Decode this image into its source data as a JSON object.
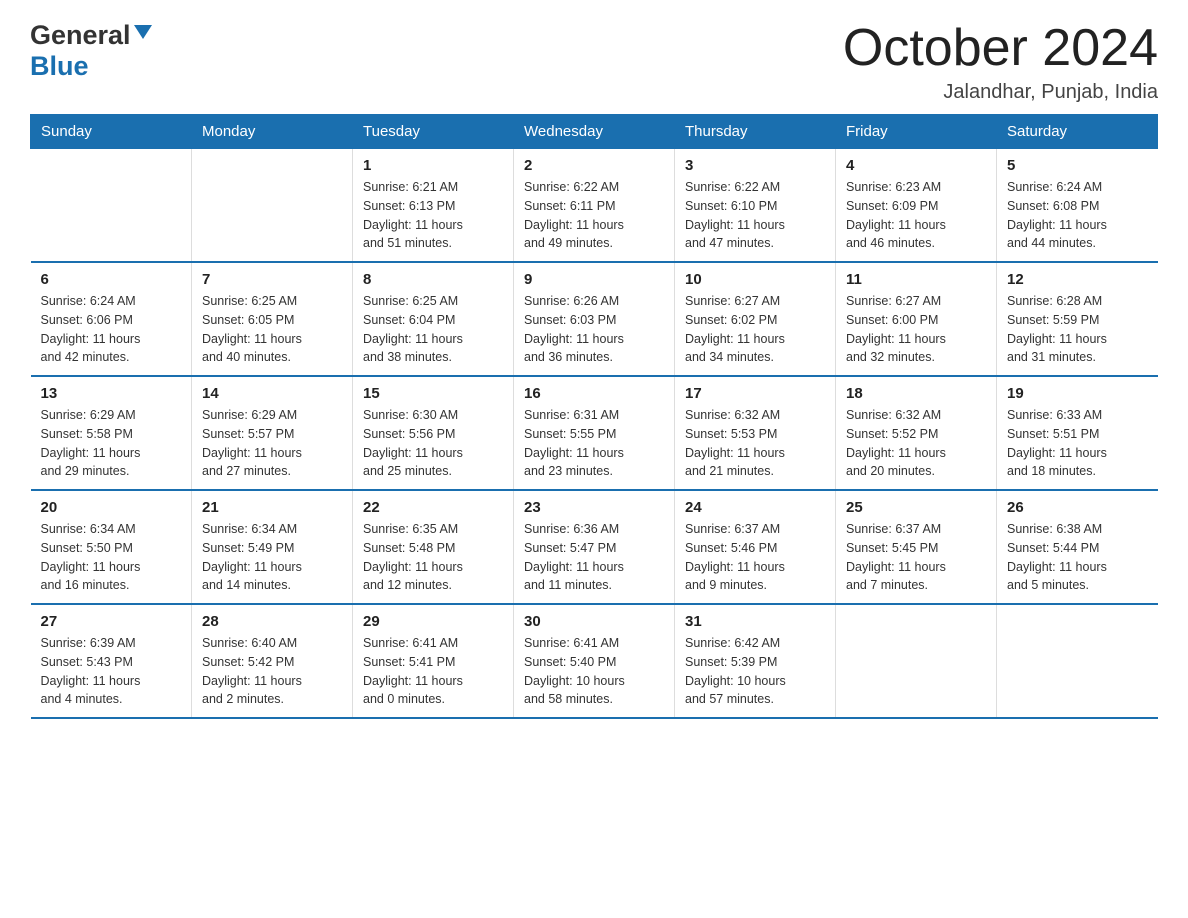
{
  "header": {
    "logo_general": "General",
    "logo_blue": "Blue",
    "month_title": "October 2024",
    "location": "Jalandhar, Punjab, India"
  },
  "weekdays": [
    "Sunday",
    "Monday",
    "Tuesday",
    "Wednesday",
    "Thursday",
    "Friday",
    "Saturday"
  ],
  "weeks": [
    [
      {
        "day": "",
        "info": ""
      },
      {
        "day": "",
        "info": ""
      },
      {
        "day": "1",
        "info": "Sunrise: 6:21 AM\nSunset: 6:13 PM\nDaylight: 11 hours\nand 51 minutes."
      },
      {
        "day": "2",
        "info": "Sunrise: 6:22 AM\nSunset: 6:11 PM\nDaylight: 11 hours\nand 49 minutes."
      },
      {
        "day": "3",
        "info": "Sunrise: 6:22 AM\nSunset: 6:10 PM\nDaylight: 11 hours\nand 47 minutes."
      },
      {
        "day": "4",
        "info": "Sunrise: 6:23 AM\nSunset: 6:09 PM\nDaylight: 11 hours\nand 46 minutes."
      },
      {
        "day": "5",
        "info": "Sunrise: 6:24 AM\nSunset: 6:08 PM\nDaylight: 11 hours\nand 44 minutes."
      }
    ],
    [
      {
        "day": "6",
        "info": "Sunrise: 6:24 AM\nSunset: 6:06 PM\nDaylight: 11 hours\nand 42 minutes."
      },
      {
        "day": "7",
        "info": "Sunrise: 6:25 AM\nSunset: 6:05 PM\nDaylight: 11 hours\nand 40 minutes."
      },
      {
        "day": "8",
        "info": "Sunrise: 6:25 AM\nSunset: 6:04 PM\nDaylight: 11 hours\nand 38 minutes."
      },
      {
        "day": "9",
        "info": "Sunrise: 6:26 AM\nSunset: 6:03 PM\nDaylight: 11 hours\nand 36 minutes."
      },
      {
        "day": "10",
        "info": "Sunrise: 6:27 AM\nSunset: 6:02 PM\nDaylight: 11 hours\nand 34 minutes."
      },
      {
        "day": "11",
        "info": "Sunrise: 6:27 AM\nSunset: 6:00 PM\nDaylight: 11 hours\nand 32 minutes."
      },
      {
        "day": "12",
        "info": "Sunrise: 6:28 AM\nSunset: 5:59 PM\nDaylight: 11 hours\nand 31 minutes."
      }
    ],
    [
      {
        "day": "13",
        "info": "Sunrise: 6:29 AM\nSunset: 5:58 PM\nDaylight: 11 hours\nand 29 minutes."
      },
      {
        "day": "14",
        "info": "Sunrise: 6:29 AM\nSunset: 5:57 PM\nDaylight: 11 hours\nand 27 minutes."
      },
      {
        "day": "15",
        "info": "Sunrise: 6:30 AM\nSunset: 5:56 PM\nDaylight: 11 hours\nand 25 minutes."
      },
      {
        "day": "16",
        "info": "Sunrise: 6:31 AM\nSunset: 5:55 PM\nDaylight: 11 hours\nand 23 minutes."
      },
      {
        "day": "17",
        "info": "Sunrise: 6:32 AM\nSunset: 5:53 PM\nDaylight: 11 hours\nand 21 minutes."
      },
      {
        "day": "18",
        "info": "Sunrise: 6:32 AM\nSunset: 5:52 PM\nDaylight: 11 hours\nand 20 minutes."
      },
      {
        "day": "19",
        "info": "Sunrise: 6:33 AM\nSunset: 5:51 PM\nDaylight: 11 hours\nand 18 minutes."
      }
    ],
    [
      {
        "day": "20",
        "info": "Sunrise: 6:34 AM\nSunset: 5:50 PM\nDaylight: 11 hours\nand 16 minutes."
      },
      {
        "day": "21",
        "info": "Sunrise: 6:34 AM\nSunset: 5:49 PM\nDaylight: 11 hours\nand 14 minutes."
      },
      {
        "day": "22",
        "info": "Sunrise: 6:35 AM\nSunset: 5:48 PM\nDaylight: 11 hours\nand 12 minutes."
      },
      {
        "day": "23",
        "info": "Sunrise: 6:36 AM\nSunset: 5:47 PM\nDaylight: 11 hours\nand 11 minutes."
      },
      {
        "day": "24",
        "info": "Sunrise: 6:37 AM\nSunset: 5:46 PM\nDaylight: 11 hours\nand 9 minutes."
      },
      {
        "day": "25",
        "info": "Sunrise: 6:37 AM\nSunset: 5:45 PM\nDaylight: 11 hours\nand 7 minutes."
      },
      {
        "day": "26",
        "info": "Sunrise: 6:38 AM\nSunset: 5:44 PM\nDaylight: 11 hours\nand 5 minutes."
      }
    ],
    [
      {
        "day": "27",
        "info": "Sunrise: 6:39 AM\nSunset: 5:43 PM\nDaylight: 11 hours\nand 4 minutes."
      },
      {
        "day": "28",
        "info": "Sunrise: 6:40 AM\nSunset: 5:42 PM\nDaylight: 11 hours\nand 2 minutes."
      },
      {
        "day": "29",
        "info": "Sunrise: 6:41 AM\nSunset: 5:41 PM\nDaylight: 11 hours\nand 0 minutes."
      },
      {
        "day": "30",
        "info": "Sunrise: 6:41 AM\nSunset: 5:40 PM\nDaylight: 10 hours\nand 58 minutes."
      },
      {
        "day": "31",
        "info": "Sunrise: 6:42 AM\nSunset: 5:39 PM\nDaylight: 10 hours\nand 57 minutes."
      },
      {
        "day": "",
        "info": ""
      },
      {
        "day": "",
        "info": ""
      }
    ]
  ]
}
